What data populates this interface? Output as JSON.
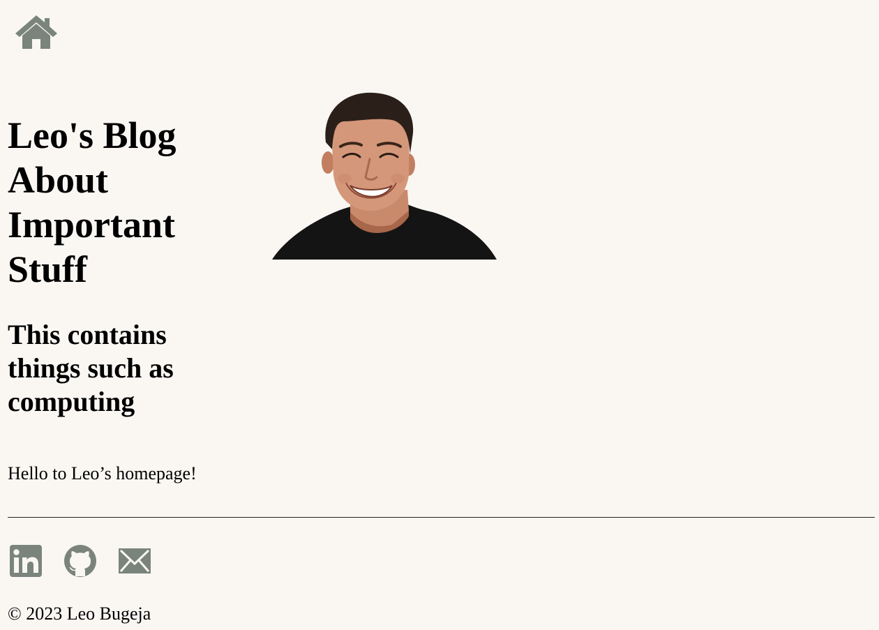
{
  "header": {
    "home_icon": "home-icon",
    "icon_color": "#7a847d"
  },
  "hero": {
    "title": "Leo's Blog About Important Stuff",
    "subtitle": "This contains things such as computing",
    "portrait": "portrait-photo"
  },
  "main": {
    "intro": "Hello to Leo’s homepage!"
  },
  "footer": {
    "social": [
      {
        "icon": "linkedin-icon"
      },
      {
        "icon": "github-icon"
      },
      {
        "icon": "mail-icon"
      }
    ],
    "copyright": "© 2023 Leo Bugeja"
  },
  "colors": {
    "background": "#faf7f3",
    "text": "#000000",
    "icon": "#7a847d"
  }
}
